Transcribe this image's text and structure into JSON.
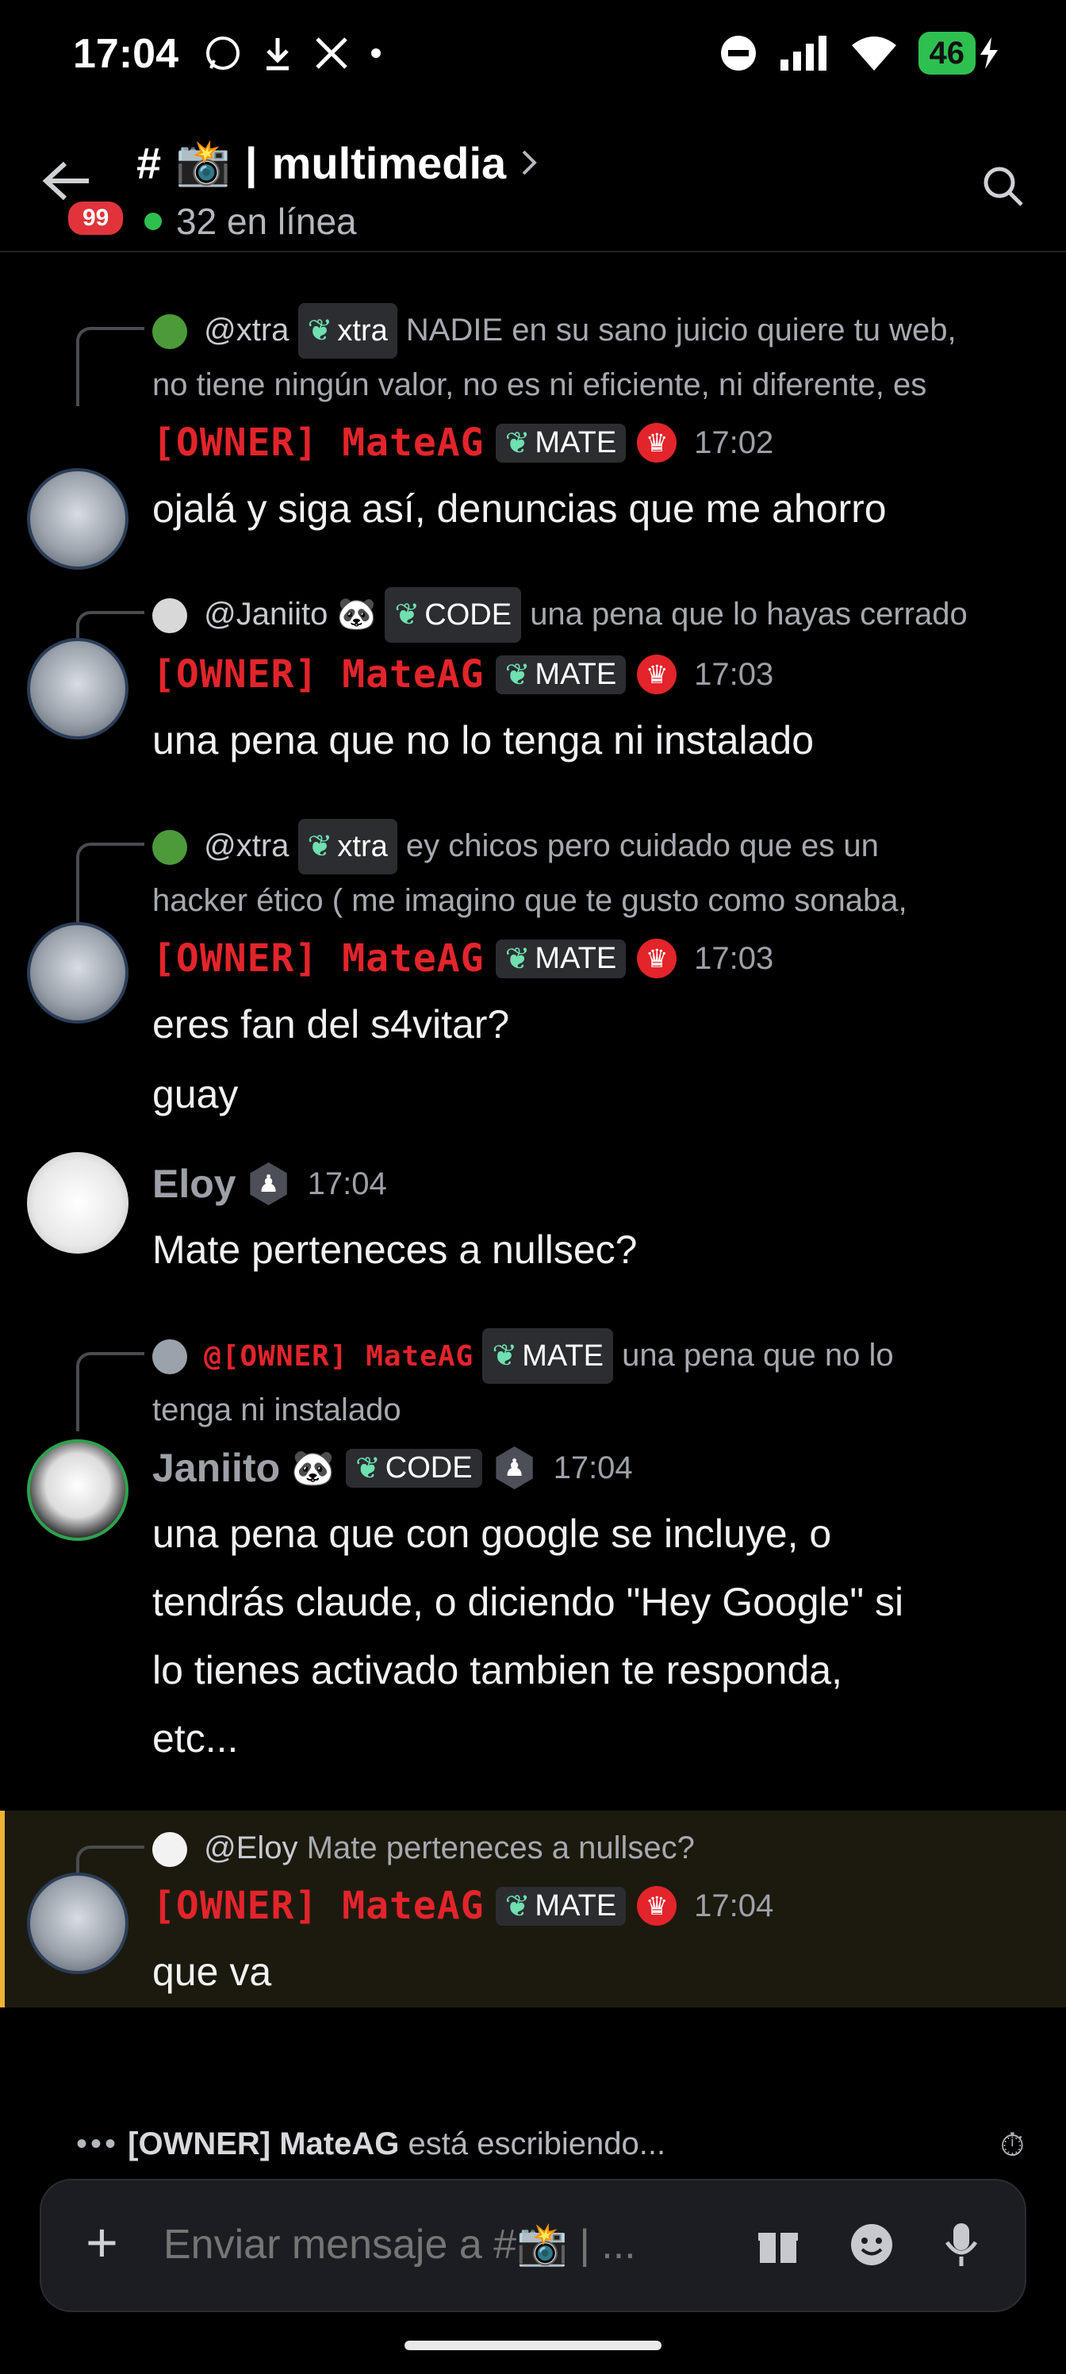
{
  "status_bar": {
    "time": "17:04",
    "battery": "46",
    "icons_left": [
      "whatsapp-icon",
      "download-icon",
      "x-icon",
      "dot-icon"
    ],
    "icons_right": [
      "dnd-icon",
      "signal-icon",
      "wifi-icon",
      "battery-icon"
    ]
  },
  "header": {
    "badge": "99",
    "hash": "#",
    "camera": "📸",
    "separator": "|",
    "channel_name": "multimedia",
    "online_text": "32 en línea"
  },
  "messages": [
    {
      "reply_to": {
        "user": "@xtra",
        "tag": "xtra",
        "text_line1": "NADIE en su sano juicio quiere tu web,",
        "text_line2": "no tiene ningún valor, no es ni eficiente, ni diferente, es"
      },
      "author": "[OWNER] MateAG",
      "tag": "MATE",
      "time": "17:02",
      "lines": [
        "ojalá y siga así, denuncias que me ahorro"
      ]
    },
    {
      "reply_to": {
        "user": "@Janiito",
        "emoji": "🐼",
        "tag": "CODE",
        "text_line1": "una pena que lo hayas cerrado"
      },
      "author": "[OWNER] MateAG",
      "tag": "MATE",
      "time": "17:03",
      "lines": [
        "una pena que no lo tenga ni instalado"
      ]
    },
    {
      "reply_to": {
        "user": "@xtra",
        "tag": "xtra",
        "text_line1": "ey chicos pero cuidado que es un",
        "text_line2": "hacker ético ( me imagino que te gusto como sonaba,"
      },
      "author": "[OWNER] MateAG",
      "tag": "MATE",
      "time": "17:03",
      "lines": [
        "eres fan del s4vitar?",
        "guay"
      ]
    },
    {
      "author": "Eloy",
      "time": "17:04",
      "lines": [
        "Mate perteneces a nullsec?"
      ]
    },
    {
      "reply_to": {
        "user": "@[OWNER] MateAG",
        "tag": "MATE",
        "text_line1": "una pena que no lo",
        "text_line2": "tenga ni instalado"
      },
      "author": "Janiito",
      "emoji": "🐼",
      "tag": "CODE",
      "time": "17:04",
      "lines": [
        "una pena que con google se incluye, o",
        "tendrás claude, o diciendo \"Hey Google\" si",
        "lo tienes activado tambien te responda,",
        "etc..."
      ]
    },
    {
      "reply_to": {
        "user": "@Eloy",
        "text_line1": "Mate perteneces a nullsec?"
      },
      "author": "[OWNER] MateAG",
      "tag": "MATE",
      "time": "17:04",
      "lines": [
        "que va"
      ]
    }
  ],
  "typing": {
    "user": "[OWNER] MateAG",
    "text": "está escribiendo..."
  },
  "composer": {
    "placeholder": "Enviar mensaje a #📸 | ..."
  },
  "colors": {
    "owner_red": "#e3242b",
    "online_green": "#2ec04f",
    "highlight_gold": "#f0b232"
  }
}
